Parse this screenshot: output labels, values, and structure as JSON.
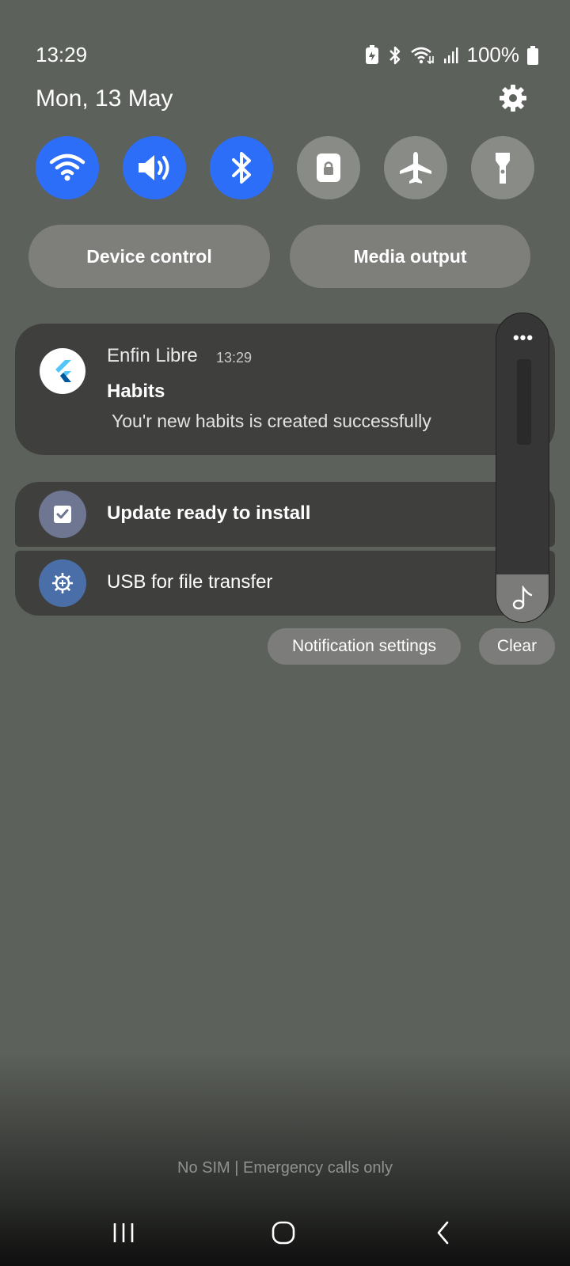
{
  "statusbar": {
    "time": "13:29",
    "battery": "100%"
  },
  "header": {
    "date": "Mon, 13 May"
  },
  "quick_settings": [
    {
      "icon": "wifi-icon",
      "state": "on"
    },
    {
      "icon": "sound-icon",
      "state": "on"
    },
    {
      "icon": "bluetooth-icon",
      "state": "on"
    },
    {
      "icon": "lock-rotation-icon",
      "state": "off"
    },
    {
      "icon": "airplane-icon",
      "state": "off"
    },
    {
      "icon": "flashlight-icon",
      "state": "off"
    }
  ],
  "buttons": {
    "device_control": "Device control",
    "media_output": "Media output"
  },
  "notification": {
    "app_name": "Enfin Libre",
    "time": "13:29",
    "title": "Habits",
    "text": "You'r new habits is created successfully"
  },
  "system_notifications": {
    "update": "Update ready to install",
    "usb": "USB for file transfer"
  },
  "actions": {
    "settings": "Notification settings",
    "clear": "Clear"
  },
  "footer": {
    "sim_status": "No SIM | Emergency calls only"
  },
  "colors": {
    "accent": "#2c6ef8",
    "card": "#3f403e",
    "background": "#5d615b"
  }
}
